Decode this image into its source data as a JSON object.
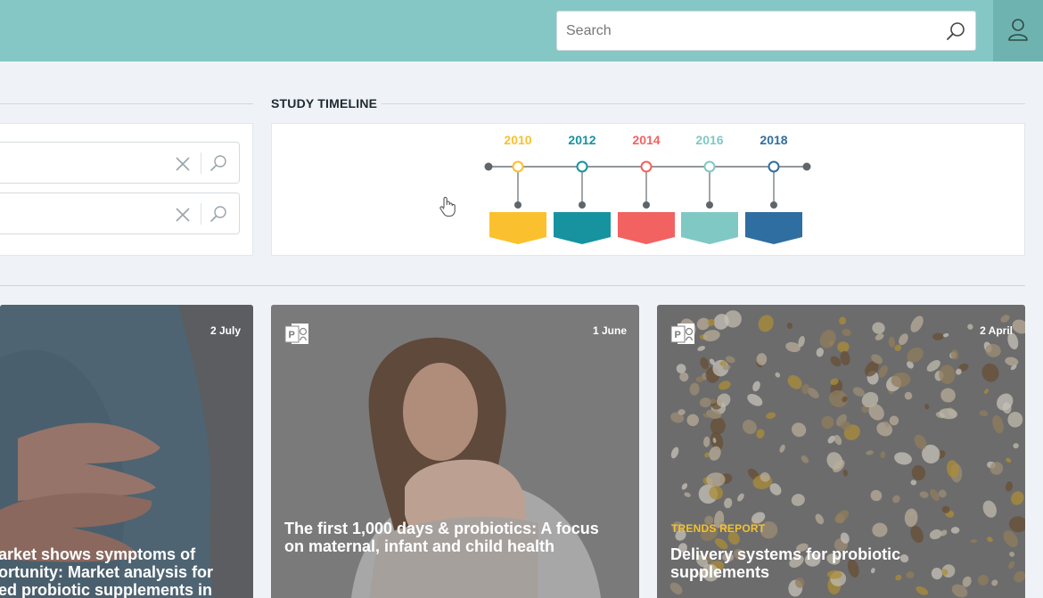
{
  "header": {
    "search_placeholder": "Search"
  },
  "timeline": {
    "heading": "STUDY TIMELINE",
    "years": [
      {
        "label": "2010",
        "color": "#fbc02d"
      },
      {
        "label": "2012",
        "color": "#16939f"
      },
      {
        "label": "2014",
        "color": "#f26260"
      },
      {
        "label": "2016",
        "color": "#80c8c4"
      },
      {
        "label": "2018",
        "color": "#2f6ea0"
      }
    ]
  },
  "cards": [
    {
      "date": "2 July",
      "title_lines": [
        "arket shows symptoms of",
        "ortunity: Market analysis for",
        "ed probiotic supplements in"
      ],
      "image": "abdomen-photo"
    },
    {
      "date": "1 June",
      "title_lines": [
        "The first 1,000 days & probiotics: A focus",
        "on maternal, infant and child health"
      ],
      "image": "mother-baby-photo",
      "icon": "presentation-doc-icon"
    },
    {
      "date": "2 April",
      "tag": "TRENDS REPORT",
      "title_lines": [
        "Delivery systems for probiotic",
        "supplements"
      ],
      "image": "pills-photo",
      "icon": "presentation-doc-icon"
    }
  ],
  "colors": {
    "header_bg": "#85c7c4",
    "user_button_bg": "#6fb3b0",
    "page_bg": "#eff3f8",
    "tag": "#f2c22e"
  }
}
